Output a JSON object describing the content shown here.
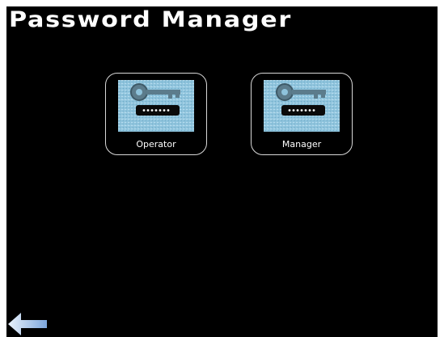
{
  "header": {
    "title": "Password Manager"
  },
  "tiles": [
    {
      "label": "Operator",
      "icon": "password-key-icon"
    },
    {
      "label": "Manager",
      "icon": "password-key-icon"
    }
  ],
  "navigation": {
    "back_icon": "back-arrow-icon"
  },
  "colors": {
    "background": "#000000",
    "text": "#ffffff",
    "tile_border": "#d8d8d8",
    "icon_fill": "#9fd0e6",
    "arrow": "#a9c8ef"
  }
}
